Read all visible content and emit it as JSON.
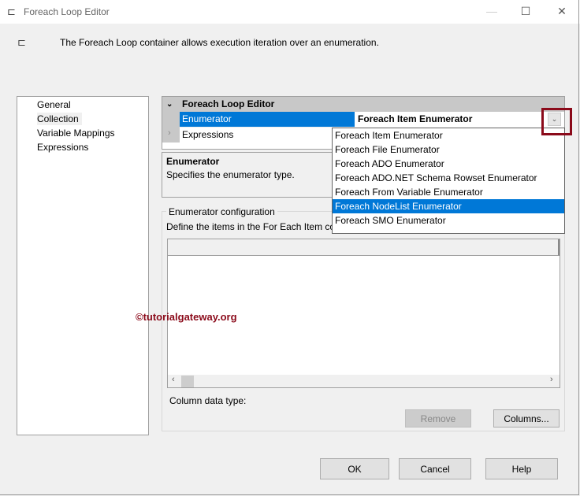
{
  "window": {
    "title": "Foreach Loop Editor",
    "description": "The Foreach Loop container allows execution iteration over an enumeration."
  },
  "nav": {
    "items": [
      "General",
      "Collection",
      "Variable Mappings",
      "Expressions"
    ],
    "selected": "Collection"
  },
  "property_grid": {
    "category": "Foreach Loop Editor",
    "rows": [
      {
        "label": "Enumerator",
        "value": "Foreach Item Enumerator"
      },
      {
        "label": "Expressions",
        "value": ""
      }
    ]
  },
  "description": {
    "title": "Enumerator",
    "text": "Specifies the enumerator type."
  },
  "dropdown": {
    "options": [
      "Foreach Item Enumerator",
      "Foreach File Enumerator",
      "Foreach ADO Enumerator",
      "Foreach ADO.NET Schema Rowset Enumerator",
      "Foreach From Variable Enumerator",
      "Foreach NodeList Enumerator",
      "Foreach SMO Enumerator"
    ],
    "highlighted": "Foreach NodeList Enumerator"
  },
  "config": {
    "legend": "Enumerator configuration",
    "define_text": "Define the items in the For Each Item co",
    "column_type_label": "Column data type:",
    "remove_label": "Remove",
    "columns_label": "Columns..."
  },
  "buttons": {
    "ok": "OK",
    "cancel": "Cancel",
    "help": "Help"
  },
  "watermark": "©tutorialgateway.org",
  "colors": {
    "selection": "#0078d7",
    "highlight_box": "#8b0a1a",
    "watermark": "#8b0a1a"
  }
}
